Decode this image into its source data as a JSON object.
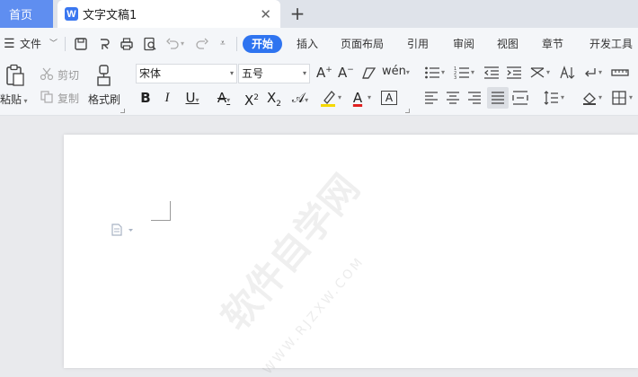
{
  "tabs": {
    "home": "首页",
    "document": "文字文稿1",
    "new_tab_symbol": "+"
  },
  "menu": {
    "file": "文件",
    "items": [
      "开始",
      "插入",
      "页面布局",
      "引用",
      "审阅",
      "视图",
      "章节",
      "开发工具"
    ],
    "active": "开始"
  },
  "ribbon": {
    "paste": "粘贴",
    "cut": "剪切",
    "copy": "复制",
    "format_painter": "格式刷",
    "font_name": "宋体",
    "font_size": "五号"
  },
  "watermark": {
    "text": "软件自学网",
    "url": "WWW.RJZXW.COM"
  },
  "colors": {
    "accent": "#2f74f0",
    "home_tab": "#5f8ef0",
    "highlight_yellow": "#f5d800",
    "font_color_red": "#e02020"
  }
}
